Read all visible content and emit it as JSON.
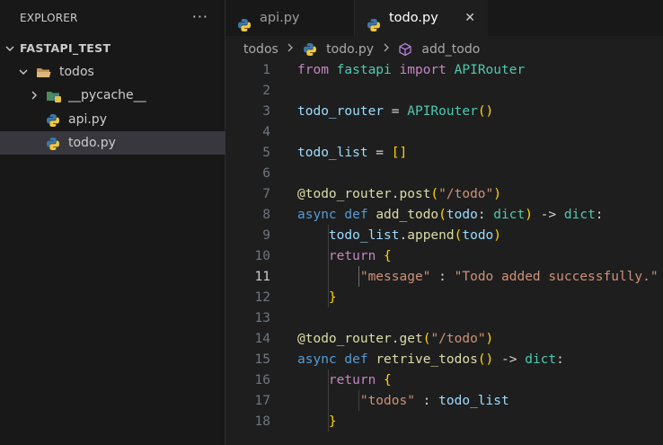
{
  "explorer": {
    "title": "EXPLORER",
    "more": "···",
    "root": "FASTAPI_TEST",
    "folder": "todos",
    "items": [
      {
        "label": "__pycache__",
        "type": "folder"
      },
      {
        "label": "api.py",
        "type": "python"
      },
      {
        "label": "todo.py",
        "type": "python",
        "selected": true
      }
    ]
  },
  "tabs": [
    {
      "label": "api.py",
      "active": false
    },
    {
      "label": "todo.py",
      "active": true,
      "close": "✕"
    }
  ],
  "breadcrumb": {
    "folder": "todos",
    "file": "todo.py",
    "symbol": "add_todo"
  },
  "editor": {
    "current_line": 11,
    "line_numbers": [
      "1",
      "2",
      "3",
      "4",
      "5",
      "6",
      "7",
      "8",
      "9",
      "10",
      "11",
      "12",
      "13",
      "14",
      "15",
      "16",
      "17",
      "18"
    ]
  },
  "colors": {
    "keyword": "#c586c0",
    "storage": "#569cd6",
    "function": "#dcdcaa",
    "variable": "#9cdcfe",
    "class": "#4ec9b0",
    "string": "#ce9178",
    "bracket_level1": "#ffd700",
    "bracket_level2": "#da70d6"
  },
  "code": [
    [
      [
        "kw",
        "from"
      ],
      [
        "pun",
        " "
      ],
      [
        "cls",
        "fastapi"
      ],
      [
        "pun",
        " "
      ],
      [
        "kw",
        "import"
      ],
      [
        "pun",
        " "
      ],
      [
        "cls",
        "APIRouter"
      ]
    ],
    [],
    [
      [
        "var",
        "todo_router"
      ],
      [
        "pun",
        " = "
      ],
      [
        "cls",
        "APIRouter"
      ],
      [
        "br1",
        "()"
      ]
    ],
    [],
    [
      [
        "var",
        "todo_list"
      ],
      [
        "pun",
        " = "
      ],
      [
        "br1",
        "[]"
      ]
    ],
    [],
    [
      [
        "fn",
        "@todo_router"
      ],
      [
        "pun",
        "."
      ],
      [
        "fn",
        "post"
      ],
      [
        "br1",
        "("
      ],
      [
        "str",
        "\"/todo\""
      ],
      [
        "br1",
        ")"
      ]
    ],
    [
      [
        "kw2",
        "async"
      ],
      [
        "pun",
        " "
      ],
      [
        "kw2",
        "def"
      ],
      [
        "pun",
        " "
      ],
      [
        "fn",
        "add_todo"
      ],
      [
        "br1",
        "("
      ],
      [
        "var",
        "todo"
      ],
      [
        "pun",
        ": "
      ],
      [
        "cls",
        "dict"
      ],
      [
        "br1",
        ")"
      ],
      [
        "pun",
        " -> "
      ],
      [
        "cls",
        "dict"
      ],
      [
        "pun",
        ":"
      ]
    ],
    [
      [
        "pun",
        "    "
      ],
      [
        "var",
        "todo_list"
      ],
      [
        "pun",
        "."
      ],
      [
        "fn",
        "append"
      ],
      [
        "br1",
        "("
      ],
      [
        "var",
        "todo"
      ],
      [
        "br1",
        ")"
      ]
    ],
    [
      [
        "pun",
        "    "
      ],
      [
        "kw",
        "return"
      ],
      [
        "pun",
        " "
      ],
      [
        "br1",
        "{"
      ]
    ],
    [
      [
        "pun",
        "        "
      ],
      [
        "str",
        "\"message\""
      ],
      [
        "pun",
        " : "
      ],
      [
        "str",
        "\"Todo added successfully.\""
      ]
    ],
    [
      [
        "pun",
        "    "
      ],
      [
        "br1",
        "}"
      ]
    ],
    [],
    [
      [
        "fn",
        "@todo_router"
      ],
      [
        "pun",
        "."
      ],
      [
        "fn",
        "get"
      ],
      [
        "br1",
        "("
      ],
      [
        "str",
        "\"/todo\""
      ],
      [
        "br1",
        ")"
      ]
    ],
    [
      [
        "kw2",
        "async"
      ],
      [
        "pun",
        " "
      ],
      [
        "kw2",
        "def"
      ],
      [
        "pun",
        " "
      ],
      [
        "fn",
        "retrive_todos"
      ],
      [
        "br1",
        "()"
      ],
      [
        "pun",
        " -> "
      ],
      [
        "cls",
        "dict"
      ],
      [
        "pun",
        ":"
      ]
    ],
    [
      [
        "pun",
        "    "
      ],
      [
        "kw",
        "return"
      ],
      [
        "pun",
        " "
      ],
      [
        "br1",
        "{"
      ]
    ],
    [
      [
        "pun",
        "        "
      ],
      [
        "str",
        "\"todos\""
      ],
      [
        "pun",
        " : "
      ],
      [
        "var",
        "todo_list"
      ]
    ],
    [
      [
        "pun",
        "    "
      ],
      [
        "br1",
        "}"
      ]
    ]
  ]
}
